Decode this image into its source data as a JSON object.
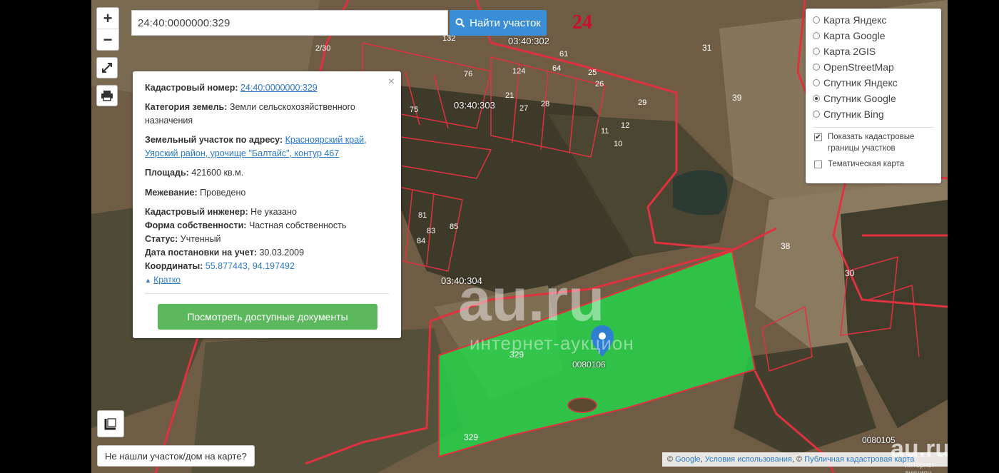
{
  "search": {
    "value": "24:40:0000000:329",
    "button_label": "Найти участок"
  },
  "region_number": "24",
  "info_panel": {
    "close_glyph": "×",
    "cadastral_number": {
      "label": "Кадастровый номер:",
      "value": "24:40:0000000:329"
    },
    "land_category": {
      "label": "Категория земель:",
      "value": "Земли сельскохозяйственного назначения"
    },
    "address": {
      "label": "Земельный участок по адресу:",
      "value": "Красноярский край, Уярский район, урочище \"Балтайс\", контур 467"
    },
    "area": {
      "label": "Площадь:",
      "value": "421600 кв.м."
    },
    "survey": {
      "label": "Межевание:",
      "value": "Проведено"
    },
    "engineer": {
      "label": "Кадастровый инженер:",
      "value": "Не указано"
    },
    "ownership": {
      "label": "Форма собственности:",
      "value": "Частная собственность"
    },
    "status": {
      "label": "Статус:",
      "value": "Учтенный"
    },
    "registration_date": {
      "label": "Дата постановки на учет:",
      "value": "30.03.2009"
    },
    "coordinates": {
      "label": "Координаты:",
      "value": "55.877443, 94.197492"
    },
    "collapse_link": "Кратко",
    "docs_button": "Посмотреть доступные документы"
  },
  "layers": {
    "base_maps": [
      {
        "label": "Карта Яндекс",
        "selected": false
      },
      {
        "label": "Карта Google",
        "selected": false
      },
      {
        "label": "Карта 2GIS",
        "selected": false
      },
      {
        "label": "OpenStreetMap",
        "selected": false
      },
      {
        "label": "Спутник Яндекс",
        "selected": false
      },
      {
        "label": "Спутник Google",
        "selected": true
      },
      {
        "label": "Спутник Bing",
        "selected": false
      }
    ],
    "overlays": [
      {
        "label": "Показать кадастровые границы участков",
        "checked": true
      },
      {
        "label": "Тематическая карта",
        "checked": false
      }
    ]
  },
  "map_labels": {
    "quarters": [
      "03:40:302",
      "03:40:303",
      "03:40:304"
    ],
    "plot_numbers": [
      "31",
      "39",
      "38",
      "30",
      "329",
      "329",
      "76",
      "75",
      "124",
      "21",
      "61",
      "64",
      "25",
      "26",
      "28",
      "27",
      "29",
      "12",
      "11",
      "10",
      "81",
      "83",
      "84",
      "85",
      "2/30",
      "132"
    ],
    "selected_plot_label": "0080106",
    "corner_plot_label": "0080105"
  },
  "controls": {
    "zoom_in": "+",
    "zoom_out": "−",
    "help_button": "Не нашли участок/дом на карте?"
  },
  "attribution": {
    "copyright_1": "©",
    "google": "Google",
    "terms": "Условия использования",
    "copyright_2": "©",
    "rosreestr": "Публичная кадастровая карта"
  },
  "watermarks": {
    "center": "au.ru",
    "center_sub": "интернет-аукцион",
    "corner": "au.ru",
    "corner_sub": "интернет-аукцион"
  },
  "colors": {
    "selected_plot_fill": "#22d84a",
    "boundary_red": "#e0313f",
    "button_blue": "#3a8ed6",
    "button_green": "#5cb85c"
  }
}
